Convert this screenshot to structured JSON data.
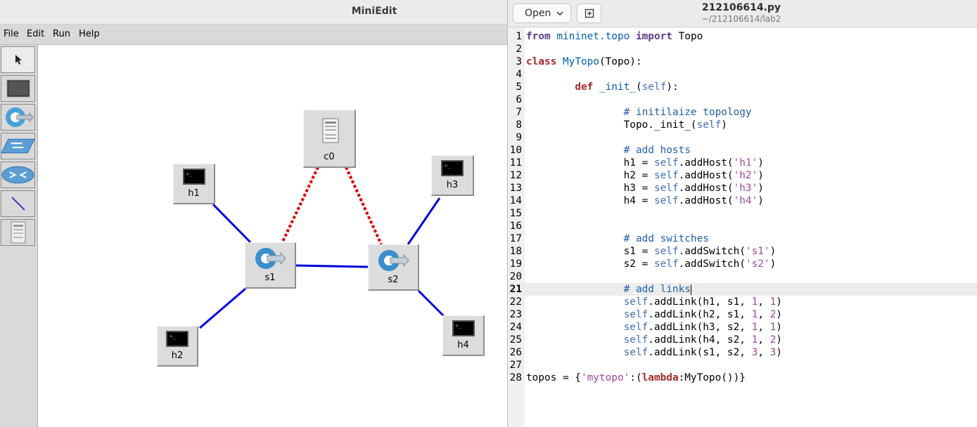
{
  "miniedit": {
    "title": "MiniEdit",
    "menu": [
      "File",
      "Edit",
      "Run",
      "Help"
    ],
    "tools": [
      {
        "name": "select",
        "icon": "arrow-cursor-icon"
      },
      {
        "name": "host",
        "icon": "host-monitor-icon"
      },
      {
        "name": "switch",
        "icon": "openflow-switch-icon"
      },
      {
        "name": "legacy-switch",
        "icon": "legacy-switch-icon"
      },
      {
        "name": "legacy-router",
        "icon": "router-icon"
      },
      {
        "name": "netlink",
        "icon": "link-line-icon"
      },
      {
        "name": "controller",
        "icon": "controller-server-icon"
      }
    ],
    "nodes": {
      "c0": "c0",
      "h1": "h1",
      "h2": "h2",
      "h3": "h3",
      "h4": "h4",
      "s1": "s1",
      "s2": "s2"
    },
    "colors": {
      "data_link": "#0000dd",
      "control_link": "#dd0000"
    }
  },
  "gedit": {
    "open_label": "Open",
    "file_name": "212106614.py",
    "file_path": "~/212106614/lab2",
    "current_line": 21,
    "lines": [
      {
        "n": "1",
        "t": "from mininet.topo import Topo"
      },
      {
        "n": "2",
        "t": ""
      },
      {
        "n": "3",
        "t": "class MyTopo(Topo):"
      },
      {
        "n": "4",
        "t": ""
      },
      {
        "n": "5",
        "t": "        def _init_(self):"
      },
      {
        "n": "6",
        "t": ""
      },
      {
        "n": "7",
        "t": "                # initilaize topology"
      },
      {
        "n": "8",
        "t": "                Topo._init_(self)"
      },
      {
        "n": "9",
        "t": ""
      },
      {
        "n": "10",
        "t": "                # add hosts"
      },
      {
        "n": "11",
        "t": "                h1 = self.addHost('h1')"
      },
      {
        "n": "12",
        "t": "                h2 = self.addHost('h2')"
      },
      {
        "n": "13",
        "t": "                h3 = self.addHost('h3')"
      },
      {
        "n": "14",
        "t": "                h4 = self.addHost('h4')"
      },
      {
        "n": "15",
        "t": ""
      },
      {
        "n": "16",
        "t": ""
      },
      {
        "n": "17",
        "t": "                # add switches"
      },
      {
        "n": "18",
        "t": "                s1 = self.addSwitch('s1')"
      },
      {
        "n": "19",
        "t": "                s2 = self.addSwitch('s2')"
      },
      {
        "n": "20",
        "t": ""
      },
      {
        "n": "21",
        "t": "                # add links"
      },
      {
        "n": "22",
        "t": "                self.addLink(h1, s1, 1, 1)"
      },
      {
        "n": "23",
        "t": "                self.addLink(h2, s1, 1, 2)"
      },
      {
        "n": "24",
        "t": "                self.addLink(h3, s2, 1, 1)"
      },
      {
        "n": "25",
        "t": "                self.addLink(h4, s2, 1, 2)"
      },
      {
        "n": "26",
        "t": "                self.addLink(s1, s2, 3, 3)"
      },
      {
        "n": "27",
        "t": ""
      },
      {
        "n": "28",
        "t": "topos = {'mytopo':(lambda:MyTopo())}"
      }
    ]
  }
}
